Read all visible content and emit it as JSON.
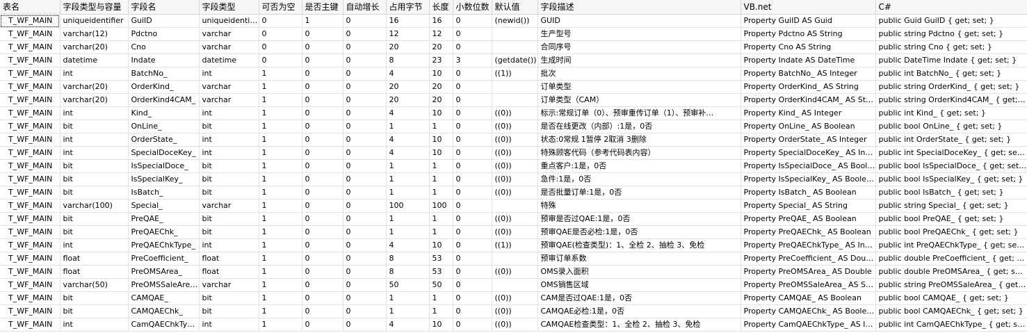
{
  "columns": [
    "表名",
    "字段类型与容量",
    "字段名",
    "字段类型",
    "可否为空",
    "是否主键",
    "自动增长",
    "占用字节",
    "长度",
    "小数位数",
    "默认值",
    "字段描述",
    "VB.net",
    "C#"
  ],
  "rows": [
    [
      "T_WF_MAIN",
      "uniqueidentifier",
      "GuiID",
      "uniqueidentifier",
      "0",
      "1",
      "0",
      "16",
      "16",
      "0",
      "(newid())",
      "GUID",
      "Property GuiID AS Guid",
      "public Guid GuiID { get; set; }"
    ],
    [
      "T_WF_MAIN",
      "varchar(12)",
      "Pdctno",
      "varchar",
      "0",
      "0",
      "0",
      "12",
      "12",
      "0",
      "",
      "生产型号",
      "Property Pdctno AS String",
      "public string Pdctno { get; set; }"
    ],
    [
      "T_WF_MAIN",
      "varchar(20)",
      "Cno",
      "varchar",
      "0",
      "0",
      "0",
      "20",
      "20",
      "0",
      "",
      "合同序号",
      "Property Cno AS String",
      "public string Cno { get; set; }"
    ],
    [
      "T_WF_MAIN",
      "datetime",
      "Indate",
      "datetime",
      "0",
      "0",
      "0",
      "8",
      "23",
      "3",
      "(getdate())",
      "生成时间",
      "Property Indate AS DateTime",
      "public DateTime Indate { get; set; }"
    ],
    [
      "T_WF_MAIN",
      "int",
      "BatchNo_",
      "int",
      "1",
      "0",
      "0",
      "4",
      "10",
      "0",
      "((1))",
      "批次",
      "Property BatchNo_ AS Integer",
      "public int BatchNo_ { get; set; }"
    ],
    [
      "T_WF_MAIN",
      "varchar(20)",
      "OrderKind_",
      "varchar",
      "1",
      "0",
      "0",
      "20",
      "20",
      "0",
      "",
      "订单类型",
      "Property OrderKind_ AS String",
      "public string OrderKind_ { get; set; }"
    ],
    [
      "T_WF_MAIN",
      "varchar(20)",
      "OrderKind4CAM_",
      "varchar",
      "1",
      "0",
      "0",
      "20",
      "20",
      "0",
      "",
      "订单类型（CAM）",
      "Property OrderKind4CAM_ AS String",
      "public string OrderKind4CAM_ { get; set; }"
    ],
    [
      "T_WF_MAIN",
      "int",
      "Kind_",
      "int",
      "1",
      "0",
      "0",
      "4",
      "10",
      "0",
      "((0))",
      "标示:常规订单（0）、预审重传订单（1）、预审补…",
      "Property Kind_ AS Integer",
      "public int Kind_ { get; set; }"
    ],
    [
      "T_WF_MAIN",
      "bit",
      "OnLine_",
      "bit",
      "1",
      "0",
      "0",
      "1",
      "1",
      "0",
      "((0))",
      "是否在线更改（内部）:1是，0否",
      "Property OnLine_ AS Boolean",
      "public bool OnLine_ { get; set; }"
    ],
    [
      "T_WF_MAIN",
      "int",
      "OrderState_",
      "int",
      "1",
      "0",
      "0",
      "4",
      "10",
      "0",
      "((0))",
      "状态:0常规 1暂停 2取消 3删除",
      "Property OrderState_ AS Integer",
      "public int OrderState_ { get; set; }"
    ],
    [
      "T_WF_MAIN",
      "int",
      "SpecialDoceKey_",
      "int",
      "1",
      "0",
      "0",
      "4",
      "10",
      "0",
      "((0))",
      "特殊顾客代码（参考代码表内容）",
      "Property SpecialDoceKey_ AS Integer",
      "public int SpecialDoceKey_ { get; set; }"
    ],
    [
      "T_WF_MAIN",
      "bit",
      "IsSpecialDoce_",
      "bit",
      "1",
      "0",
      "0",
      "1",
      "1",
      "0",
      "((0))",
      "重点客户:1是，0否",
      "Property IsSpecialDoce_ AS Boolean",
      "public bool IsSpecialDoce_ { get; set; }"
    ],
    [
      "T_WF_MAIN",
      "bit",
      "IsSpecialKey_",
      "bit",
      "1",
      "0",
      "0",
      "1",
      "1",
      "0",
      "((0))",
      "急件:1是，0否",
      "Property IsSpecialKey_ AS Boolean",
      "public bool IsSpecialKey_ { get; set; }"
    ],
    [
      "T_WF_MAIN",
      "bit",
      "IsBatch_",
      "bit",
      "1",
      "0",
      "0",
      "1",
      "1",
      "0",
      "((0))",
      "是否批量订单:1是，0否",
      "Property IsBatch_ AS Boolean",
      "public bool IsBatch_ { get; set; }"
    ],
    [
      "T_WF_MAIN",
      "varchar(100)",
      "Special_",
      "varchar",
      "1",
      "0",
      "0",
      "100",
      "100",
      "0",
      "",
      "特殊",
      "Property Special_ AS String",
      "public string Special_ { get; set; }"
    ],
    [
      "T_WF_MAIN",
      "bit",
      "PreQAE_",
      "bit",
      "1",
      "0",
      "0",
      "1",
      "1",
      "0",
      "((0))",
      "预审是否过QAE:1是，0否",
      "Property PreQAE_ AS Boolean",
      "public bool PreQAE_ { get; set; }"
    ],
    [
      "T_WF_MAIN",
      "bit",
      "PreQAEChk_",
      "bit",
      "1",
      "0",
      "0",
      "1",
      "1",
      "0",
      "((0))",
      "预审QAE是否必检:1是，0否",
      "Property PreQAEChk_ AS Boolean",
      "public bool PreQAEChk_ { get; set; }"
    ],
    [
      "T_WF_MAIN",
      "int",
      "PreQAEChkType_",
      "int",
      "1",
      "0",
      "0",
      "4",
      "10",
      "0",
      "((1))",
      "预审QAE(检查类型)：1、全检 2、抽检 3、免检",
      "Property PreQAEChkType_ AS Inte…",
      "public int PreQAEChkType_ { get; set; }"
    ],
    [
      "T_WF_MAIN",
      "float",
      "PreCoefficient_",
      "float",
      "1",
      "0",
      "0",
      "8",
      "53",
      "0",
      "",
      "预审订单系数",
      "Property PreCoefficient_ AS Double",
      "public double PreCoefficient_ { get; set; }"
    ],
    [
      "T_WF_MAIN",
      "float",
      "PreOMSArea_",
      "float",
      "1",
      "0",
      "0",
      "8",
      "53",
      "0",
      "((0))",
      "OMS录入面积",
      "Property PreOMSArea_ AS Double",
      "public double PreOMSArea_ { get; set; }"
    ],
    [
      "T_WF_MAIN",
      "varchar(50)",
      "PreOMSSaleAre…",
      "varchar",
      "1",
      "0",
      "0",
      "50",
      "50",
      "0",
      "",
      "OMS销售区域",
      "Property PreOMSSaleArea_ AS String",
      "public string PreOMSSaleArea_ { get; s…"
    ],
    [
      "T_WF_MAIN",
      "bit",
      "CAMQAE_",
      "bit",
      "1",
      "0",
      "0",
      "1",
      "1",
      "0",
      "((0))",
      "CAM是否过QAE:1是，0否",
      "Property CAMQAE_ AS Boolean",
      "public bool CAMQAE_ { get; set; }"
    ],
    [
      "T_WF_MAIN",
      "bit",
      "CAMQAEChk_",
      "bit",
      "1",
      "0",
      "0",
      "1",
      "1",
      "0",
      "((0))",
      "CAMQAE必检:1是，0否",
      "Property CAMQAEChk_ AS Boolean",
      "public bool CAMQAEChk_ { get; set; }"
    ],
    [
      "T_WF_MAIN",
      "int",
      "CamQAEChkTy…",
      "int",
      "1",
      "0",
      "0",
      "4",
      "10",
      "0",
      "((0))",
      "CAMQAE检查类型：1、全检 2、抽检 3、免检",
      "Property CamQAEChkType_ AS Inte…",
      "public int CamQAEChkType_ { get; set; }"
    ]
  ]
}
